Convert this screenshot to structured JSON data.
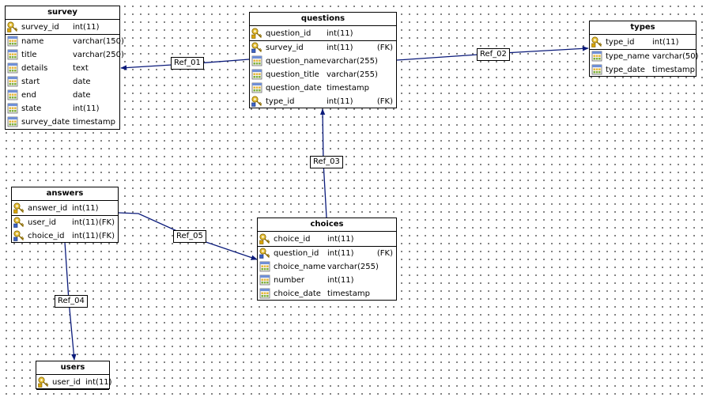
{
  "colors": {
    "line": "#0a1a7a",
    "border": "#000000"
  },
  "tables": [
    {
      "id": "survey",
      "title": "survey",
      "columns": [
        {
          "name": "survey_id",
          "type": "int(11)",
          "key": "pk",
          "fk": ""
        },
        {
          "name": "name",
          "type": "varchar(150)",
          "key": "",
          "fk": ""
        },
        {
          "name": "title",
          "type": "varchar(250)",
          "key": "",
          "fk": ""
        },
        {
          "name": "details",
          "type": "text",
          "key": "",
          "fk": ""
        },
        {
          "name": "start",
          "type": "date",
          "key": "",
          "fk": ""
        },
        {
          "name": "end",
          "type": "date",
          "key": "",
          "fk": ""
        },
        {
          "name": "state",
          "type": "int(11)",
          "key": "",
          "fk": ""
        },
        {
          "name": "survey_date",
          "type": "timestamp",
          "key": "",
          "fk": ""
        }
      ]
    },
    {
      "id": "questions",
      "title": "questions",
      "columns": [
        {
          "name": "question_id",
          "type": "int(11)",
          "key": "pk",
          "fk": ""
        },
        {
          "name": "survey_id",
          "type": "int(11)",
          "key": "fkey",
          "fk": "(FK)"
        },
        {
          "name": "question_name",
          "type": "varchar(255)",
          "key": "",
          "fk": ""
        },
        {
          "name": "question_title",
          "type": "varchar(255)",
          "key": "",
          "fk": ""
        },
        {
          "name": "question_date",
          "type": "timestamp",
          "key": "",
          "fk": ""
        },
        {
          "name": "type_id",
          "type": "int(11)",
          "key": "fkey",
          "fk": "(FK)"
        }
      ]
    },
    {
      "id": "types",
      "title": "types",
      "columns": [
        {
          "name": "type_id",
          "type": "int(11)",
          "key": "pk",
          "fk": ""
        },
        {
          "name": "type_name",
          "type": "varchar(50)",
          "key": "",
          "fk": ""
        },
        {
          "name": "type_date",
          "type": "timestamp",
          "key": "",
          "fk": ""
        }
      ]
    },
    {
      "id": "answers",
      "title": "answers",
      "columns": [
        {
          "name": "answer_id",
          "type": "int(11)",
          "key": "pk",
          "fk": ""
        },
        {
          "name": "user_id",
          "type": "int(11)",
          "key": "fkey",
          "fk": "(FK)"
        },
        {
          "name": "choice_id",
          "type": "int(11)",
          "key": "fkey",
          "fk": "(FK)"
        }
      ]
    },
    {
      "id": "choices",
      "title": "choices",
      "columns": [
        {
          "name": "choice_id",
          "type": "int(11)",
          "key": "pk",
          "fk": ""
        },
        {
          "name": "question_id",
          "type": "int(11)",
          "key": "fkey",
          "fk": "(FK)"
        },
        {
          "name": "choice_name",
          "type": "varchar(255)",
          "key": "",
          "fk": ""
        },
        {
          "name": "number",
          "type": "int(11)",
          "key": "",
          "fk": ""
        },
        {
          "name": "choice_date",
          "type": "timestamp",
          "key": "",
          "fk": ""
        }
      ]
    },
    {
      "id": "users",
      "title": "users",
      "columns": [
        {
          "name": "user_id",
          "type": "int(11)",
          "key": "pk",
          "fk": ""
        }
      ]
    }
  ],
  "refs": [
    {
      "id": "ref_01",
      "label": "Ref_01",
      "from": "questions",
      "to": "survey"
    },
    {
      "id": "ref_02",
      "label": "Ref_02",
      "from": "questions",
      "to": "types"
    },
    {
      "id": "ref_03",
      "label": "Ref_03",
      "from": "choices",
      "to": "questions"
    },
    {
      "id": "ref_04",
      "label": "Ref_04",
      "from": "answers",
      "to": "users"
    },
    {
      "id": "ref_05",
      "label": "Ref_05",
      "from": "answers",
      "to": "choices"
    }
  ]
}
